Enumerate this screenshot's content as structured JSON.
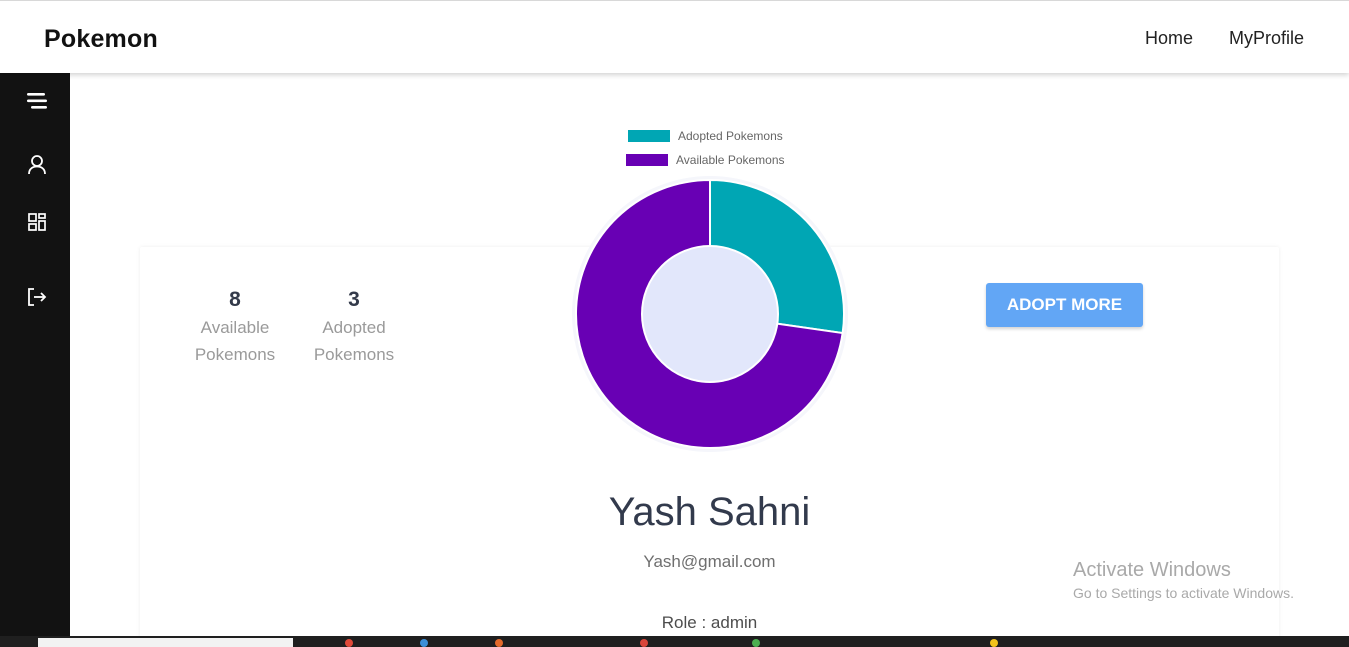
{
  "header": {
    "brand": "Pokemon",
    "nav": [
      {
        "label": "Home"
      },
      {
        "label": "MyProfile"
      }
    ]
  },
  "sidebar": {
    "icons": [
      "menu-icon",
      "user-icon",
      "dashboard-icon",
      "logout-icon"
    ]
  },
  "stats": [
    {
      "value": "8",
      "label_line1": "Available",
      "label_line2": "Pokemons"
    },
    {
      "value": "3",
      "label_line1": "Adopted",
      "label_line2": "Pokemons"
    }
  ],
  "adopt_button": "ADOPT MORE",
  "profile": {
    "name": "Yash Sahni",
    "email": "Yash@gmail.com",
    "role": "Role : admin"
  },
  "chart_data": {
    "type": "pie",
    "labels": [
      "Adopted Pokemons",
      "Available Pokemons"
    ],
    "values": [
      3,
      8
    ],
    "colors": [
      "#00a6b4",
      "#6800b4"
    ],
    "legend": "top"
  },
  "colors": {
    "sidebar": "#121212",
    "button": "#62a6f5",
    "donut_center": "#e2e7fb"
  },
  "os_watermark": {
    "title": "Activate Windows",
    "subtitle": "Go to Settings to activate Windows."
  }
}
